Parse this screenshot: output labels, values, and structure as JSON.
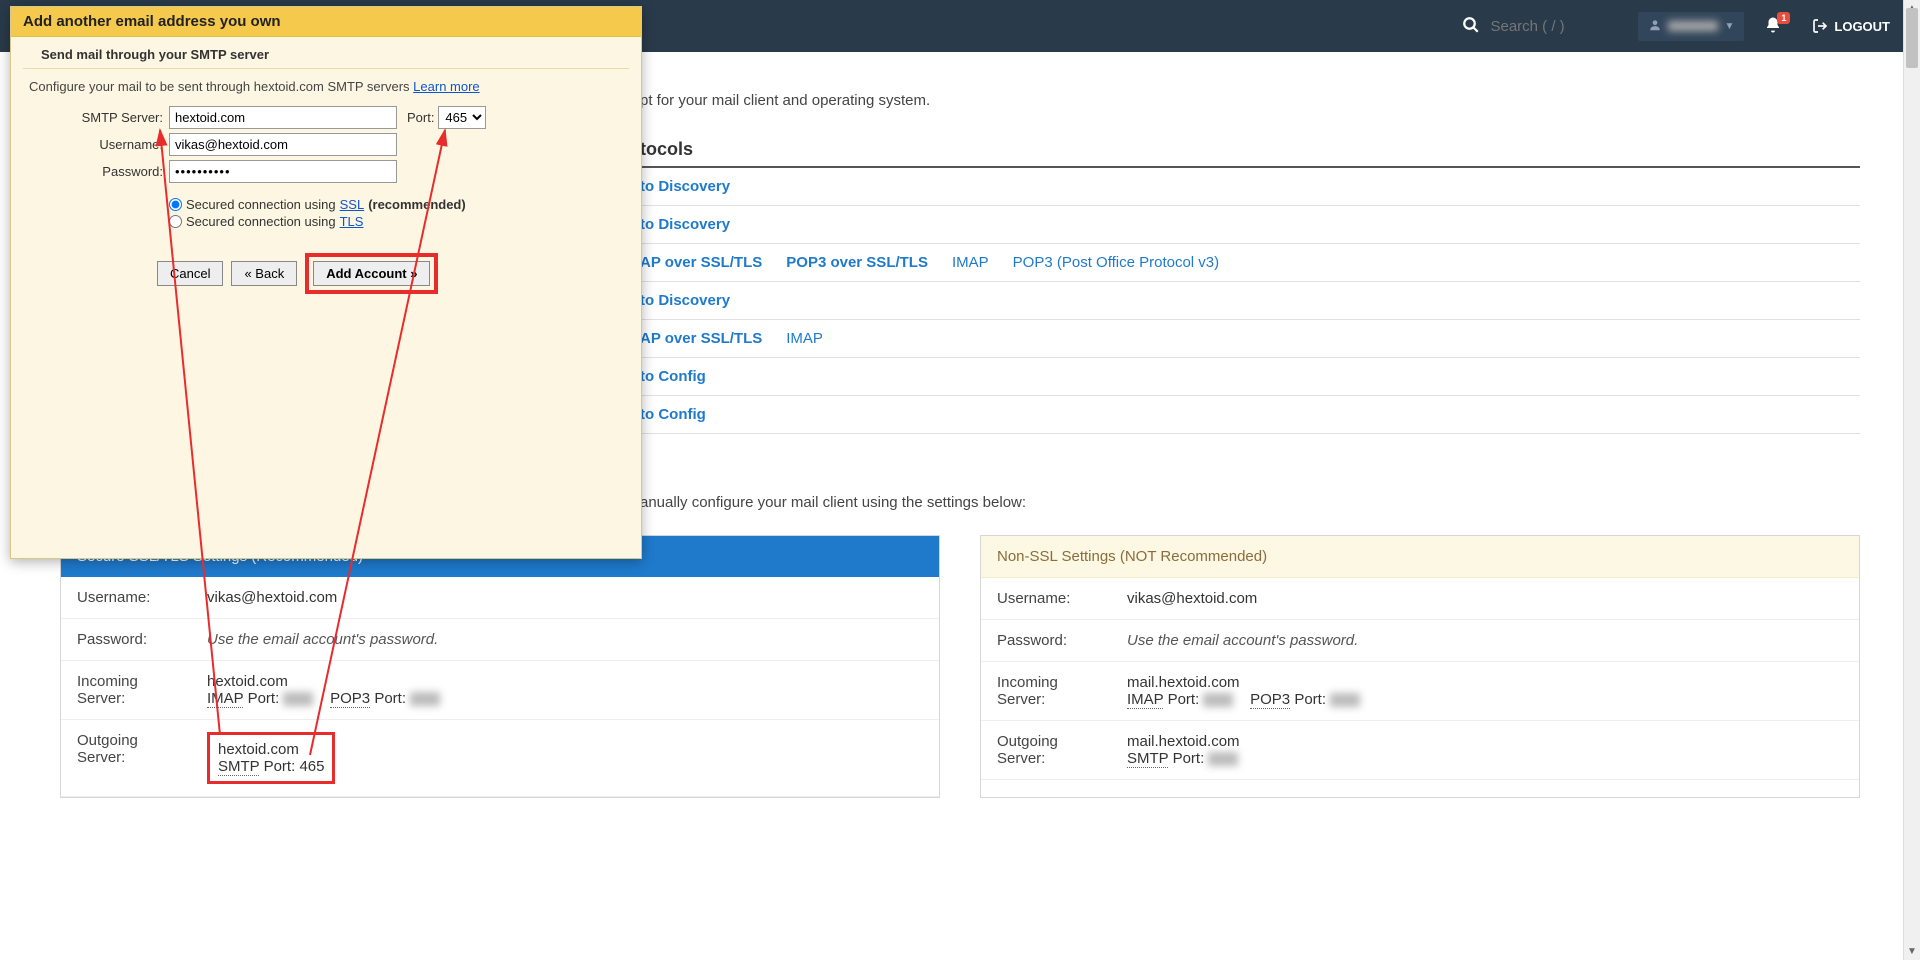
{
  "topnav": {
    "search_placeholder": "Search ( / )",
    "bell_badge": "1",
    "logout_label": "LOGOUT"
  },
  "intro": "pt for your mail client and operating system.",
  "section_title": "tocols",
  "protocols": [
    [
      {
        "text": "to Discovery",
        "bold": true
      }
    ],
    [
      {
        "text": "to Discovery",
        "bold": true
      }
    ],
    [
      {
        "text": "AP over SSL/TLS",
        "bold": true
      },
      {
        "text": "POP3 over SSL/TLS",
        "bold": true
      },
      {
        "text": "IMAP",
        "bold": false
      },
      {
        "text": "POP3 (Post Office Protocol v3)",
        "bold": false
      }
    ],
    [
      {
        "text": "to Discovery",
        "bold": true
      }
    ],
    [
      {
        "text": "AP over SSL/TLS",
        "bold": true
      },
      {
        "text": "IMAP",
        "bold": false
      }
    ],
    [
      {
        "text": "to Config",
        "bold": true
      }
    ],
    [
      {
        "text": "to Config",
        "bold": true
      }
    ]
  ],
  "manual_text": "anually configure your mail client using the settings below:",
  "panels": {
    "secure": {
      "title": "Secure SSL/TLS Settings (Recommended)",
      "username_k": "Username:",
      "username_v": "vikas@hextoid.com",
      "password_k": "Password:",
      "password_v": "Use the email account's password.",
      "incoming_k": "Incoming Server:",
      "incoming_host": "hextoid.com",
      "imap_label": "IMAP",
      "port_label": "Port:",
      "pop3_label": "POP3",
      "outgoing_k": "Outgoing Server:",
      "outgoing_host": "hextoid.com",
      "smtp_label": "SMTP",
      "smtp_port": "465"
    },
    "nonssl": {
      "title": "Non-SSL Settings (NOT Recommended)",
      "username_k": "Username:",
      "username_v": "vikas@hextoid.com",
      "password_k": "Password:",
      "password_v": "Use the email account's password.",
      "incoming_k": "Incoming Server:",
      "incoming_host": "mail.hextoid.com",
      "imap_label": "IMAP",
      "port_label": "Port:",
      "pop3_label": "POP3",
      "outgoing_k": "Outgoing Server:",
      "outgoing_host": "mail.hextoid.com",
      "smtp_label": "SMTP"
    }
  },
  "dialog": {
    "title": "Add another email address you own",
    "subtitle": "Send mail through your SMTP server",
    "desc_prefix": "Configure your mail to be sent through hextoid.com SMTP servers ",
    "learn_more": "Learn more",
    "server_label": "SMTP Server:",
    "server_value": "hextoid.com",
    "port_label": "Port:",
    "port_value": "465",
    "user_label": "Username:",
    "user_value": "vikas@hextoid.com",
    "pass_label": "Password:",
    "pass_value": "••••••••••",
    "radio_ssl_prefix": "Secured connection using ",
    "radio_ssl_link": "SSL",
    "radio_ssl_suffix": " (recommended)",
    "radio_tls_prefix": "Secured connection using ",
    "radio_tls_link": "TLS",
    "btn_cancel": "Cancel",
    "btn_back": "« Back",
    "btn_add": "Add Account »"
  }
}
